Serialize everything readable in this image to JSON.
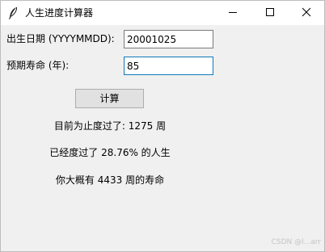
{
  "window": {
    "title": "人生进度计算器"
  },
  "form": {
    "birth_label": "出生日期 (YYYYMMDD):",
    "birth_value": "20001025",
    "life_label": "预期寿命 (年):",
    "life_value": "85"
  },
  "actions": {
    "calculate_label": "计算"
  },
  "results": {
    "weeks_passed": "目前为止度过了: 1275 周",
    "percent_lived": "已经度过了 28.76% 的人生",
    "weeks_left": "你大概有 4433 周的寿命"
  },
  "watermark": "CSDN @l...arr",
  "colors": {
    "window_bg": "#f0f0f0",
    "titlebar_bg": "#ffffff",
    "focus_border": "#0f7bb8",
    "button_bg": "#e1e1e1"
  },
  "icons": {
    "app": "feather-icon",
    "minimize": "minimize-icon",
    "maximize": "maximize-icon",
    "close": "close-icon"
  }
}
